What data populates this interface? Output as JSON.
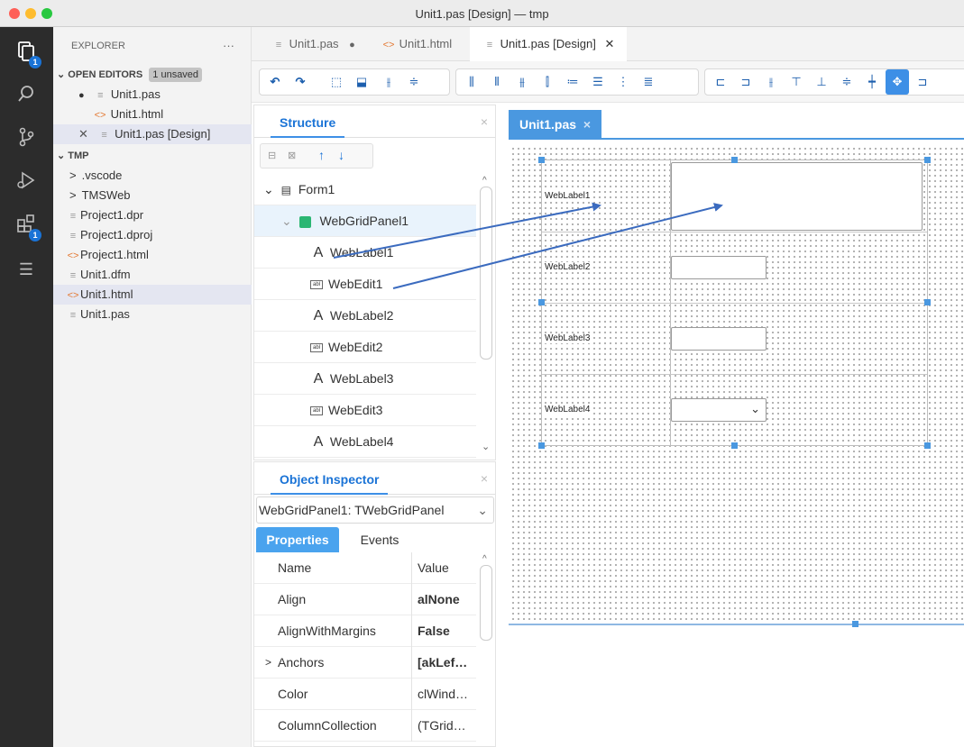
{
  "window": {
    "title": "Unit1.pas [Design] — tmp"
  },
  "colors": {
    "accent": "#3d8fe6",
    "badge": "#1a73d6",
    "activity_bar": "#2c2c2c",
    "arrow": "#3b6bbf"
  },
  "activity_bar": {
    "badges": [
      "1",
      "1"
    ]
  },
  "explorer": {
    "title": "EXPLORER",
    "more": "···",
    "open_editors": {
      "label": "OPEN EDITORS",
      "unsaved": "1 unsaved",
      "items": [
        {
          "label": "Unit1.pas",
          "icon": "file-lines-icon",
          "prefix": "●"
        },
        {
          "label": "Unit1.html",
          "icon": "html-file-icon",
          "prefix": ""
        },
        {
          "label": "Unit1.pas [Design]",
          "icon": "file-lines-icon",
          "prefix": "✕"
        }
      ]
    },
    "project": {
      "label": "TMP",
      "items": [
        {
          "label": ".vscode",
          "icon": "chevron-right-icon"
        },
        {
          "label": "TMSWeb",
          "icon": "chevron-right-icon"
        },
        {
          "label": "Project1.dpr",
          "icon": "file-lines-icon"
        },
        {
          "label": "Project1.dproj",
          "icon": "file-lines-icon"
        },
        {
          "label": "Project1.html",
          "icon": "html-file-icon"
        },
        {
          "label": "Unit1.dfm",
          "icon": "file-lines-icon"
        },
        {
          "label": "Unit1.html",
          "icon": "html-file-icon"
        },
        {
          "label": "Unit1.pas",
          "icon": "file-lines-icon"
        }
      ]
    }
  },
  "tabs": [
    {
      "label": "Unit1.pas",
      "marker": "●"
    },
    {
      "label": "Unit1.html",
      "marker": ""
    },
    {
      "label": "Unit1.pas [Design]",
      "marker": "✕"
    }
  ],
  "structure": {
    "title": "Structure",
    "close": "×",
    "up": "↑",
    "down": "↓",
    "items": [
      {
        "label": "Form1",
        "type": "form"
      },
      {
        "label": "WebGridPanel1",
        "type": "panel"
      },
      {
        "label": "WebLabel1",
        "type": "label"
      },
      {
        "label": "WebEdit1",
        "type": "edit"
      },
      {
        "label": "WebLabel2",
        "type": "label"
      },
      {
        "label": "WebEdit2",
        "type": "edit"
      },
      {
        "label": "WebLabel3",
        "type": "label"
      },
      {
        "label": "WebEdit3",
        "type": "edit"
      },
      {
        "label": "WebLabel4",
        "type": "label"
      }
    ]
  },
  "object_inspector": {
    "title": "Object Inspector",
    "close": "×",
    "selected": "WebGridPanel1: TWebGridPanel",
    "tabs": [
      "Properties",
      "Events"
    ],
    "columns": {
      "name": "Name",
      "value": "Value"
    },
    "rows": [
      {
        "name": "Align",
        "value": "alNone",
        "bold": true
      },
      {
        "name": "AlignWithMargins",
        "value": "False",
        "bold": true
      },
      {
        "name": "Anchors",
        "value": "[akLef…",
        "bold": true,
        "expand": ">"
      },
      {
        "name": "Color",
        "value": "clWind…",
        "bold": false
      },
      {
        "name": "ColumnCollection",
        "value": "(TGrid…",
        "bold": false
      }
    ]
  },
  "designer": {
    "tab": "Unit1.pas",
    "tab_close": "×",
    "labels": [
      "WebLabel1",
      "WebLabel2",
      "WebLabel3",
      "WebLabel4"
    ]
  }
}
